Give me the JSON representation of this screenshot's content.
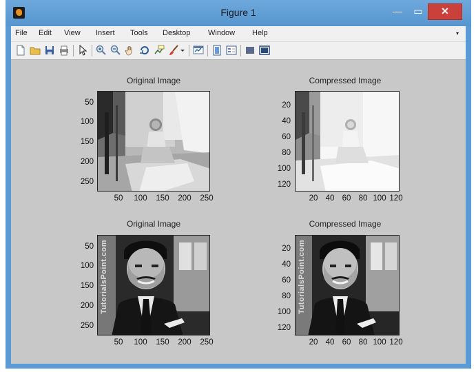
{
  "window": {
    "title": "Figure 1",
    "close_glyph": "✕",
    "min_glyph": "—",
    "max_glyph": "▭"
  },
  "menubar": {
    "items": [
      "File",
      "Edit",
      "View",
      "Insert",
      "Tools",
      "Desktop",
      "Window",
      "Help"
    ],
    "overflow_glyph": "▾"
  },
  "toolbar": {
    "icons": [
      "new-figure-icon",
      "open-file-icon",
      "save-icon",
      "print-icon",
      "pointer-icon",
      "zoom-in-icon",
      "zoom-out-icon",
      "pan-icon",
      "rotate-3d-icon",
      "data-cursor-icon",
      "brush-icon",
      "brush-dropdown-icon",
      "link-plot-icon",
      "colorbar-icon",
      "legend-icon",
      "hide-plot-tools-icon",
      "show-plot-tools-icon"
    ]
  },
  "plots": [
    {
      "title": "Original Image",
      "yticks": [
        "50",
        "100",
        "150",
        "200",
        "250"
      ],
      "xticks": [
        "50",
        "100",
        "150",
        "200",
        "250"
      ]
    },
    {
      "title": "Compressed Image",
      "yticks": [
        "20",
        "40",
        "60",
        "80",
        "100",
        "120"
      ],
      "xticks": [
        "20",
        "40",
        "60",
        "80",
        "100",
        "120"
      ]
    },
    {
      "title": "Original Image",
      "yticks": [
        "50",
        "100",
        "150",
        "200",
        "250"
      ],
      "xticks": [
        "50",
        "100",
        "150",
        "200",
        "250"
      ],
      "watermark": "TutorialsPoint.com"
    },
    {
      "title": "Compressed Image",
      "yticks": [
        "20",
        "40",
        "60",
        "80",
        "100",
        "120"
      ],
      "xticks": [
        "20",
        "40",
        "60",
        "80",
        "100",
        "120"
      ],
      "watermark": "TutorialsPoint.com"
    }
  ]
}
